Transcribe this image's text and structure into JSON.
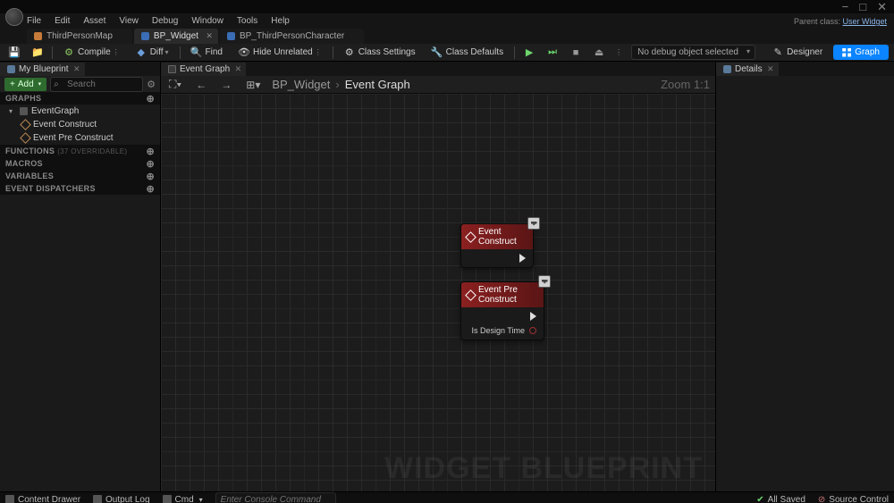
{
  "window": {
    "minimize": "−",
    "maximize": "□",
    "close": "✕"
  },
  "menu": [
    "File",
    "Edit",
    "Asset",
    "View",
    "Debug",
    "Window",
    "Tools",
    "Help"
  ],
  "parent": {
    "label": "Parent class:",
    "value": "User Widget"
  },
  "tabs": [
    {
      "label": "ThirdPersonMap",
      "active": false,
      "icon": "map"
    },
    {
      "label": "BP_Widget",
      "active": true,
      "icon": "bp"
    },
    {
      "label": "BP_ThirdPersonCharacter",
      "active": false,
      "icon": "bp"
    }
  ],
  "toolbar": {
    "compile": "Compile",
    "diff": "Diff",
    "find": "Find",
    "hide_unrelated": "Hide Unrelated",
    "class_settings": "Class Settings",
    "class_defaults": "Class Defaults",
    "debug_object": "No debug object selected",
    "designer": "Designer",
    "graph": "Graph"
  },
  "my_blueprint": {
    "title": "My Blueprint",
    "add": "Add",
    "search_ph": "Search",
    "sections": {
      "graphs": "GRAPHS",
      "functions": "FUNCTIONS",
      "functions_sub": "(37 OVERRIDABLE)",
      "macros": "MACROS",
      "variables": "VARIABLES",
      "dispatchers": "EVENT DISPATCHERS"
    },
    "tree": {
      "event_graph": "EventGraph",
      "event_construct": "Event Construct",
      "event_pre_construct": "Event Pre Construct"
    }
  },
  "graph": {
    "tab": "Event Graph",
    "breadcrumb1": "BP_Widget",
    "breadcrumb2": "Event Graph",
    "zoom": "Zoom 1:1",
    "watermark": "WIDGET BLUEPRINT",
    "nodes": {
      "construct": {
        "title": "Event Construct"
      },
      "pre_construct": {
        "title": "Event Pre Construct",
        "pin1": "Is Design Time"
      }
    }
  },
  "details": {
    "title": "Details"
  },
  "bottom": {
    "content_drawer": "Content Drawer",
    "output_log": "Output Log",
    "cmd_label": "Cmd",
    "cmd_ph": "Enter Console Command",
    "all_saved": "All Saved",
    "source_control": "Source Control"
  }
}
